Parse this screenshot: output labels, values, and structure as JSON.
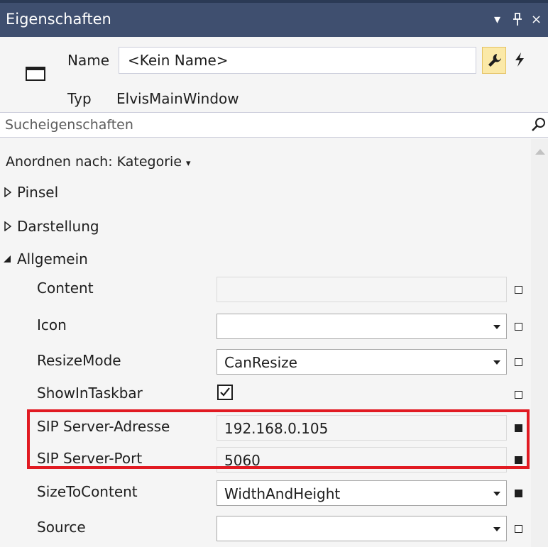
{
  "window": {
    "title": "Eigenschaften",
    "dropdown_icon": "▾",
    "pin_icon": "Д",
    "close_icon": "×"
  },
  "header": {
    "name_label": "Name",
    "name_value": "<Kein Name>",
    "type_label": "Typ",
    "type_value": "ElvisMainWindow"
  },
  "search": {
    "placeholder": "Sucheigenschaften"
  },
  "arrange": {
    "label": "Anordnen nach: Kategorie",
    "caret": "▾"
  },
  "categories": {
    "pinsel": "Pinsel",
    "darstellung": "Darstellung",
    "allgemein": "Allgemein"
  },
  "properties": [
    {
      "name": "Content",
      "value": ""
    },
    {
      "name": "Icon",
      "value": ""
    },
    {
      "name": "ResizeMode",
      "value": "CanResize"
    },
    {
      "name": "ShowInTaskbar",
      "value": ""
    },
    {
      "name": "SIP Server-Adresse",
      "value": "192.168.0.105"
    },
    {
      "name": "SIP Server-Port",
      "value": "5060"
    },
    {
      "name": "SizeToContent",
      "value": "WidthAndHeight"
    },
    {
      "name": "Source",
      "value": ""
    }
  ],
  "colors": {
    "titlebar": "#3f4f6f",
    "highlight_border": "#e11a22",
    "active_tool": "#fbe9a8"
  }
}
